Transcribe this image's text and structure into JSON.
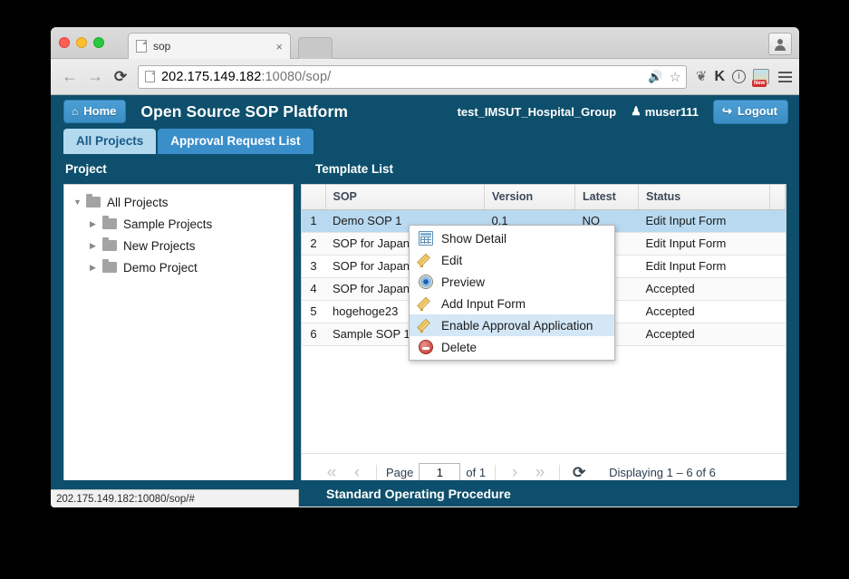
{
  "browser": {
    "tab": {
      "title": "sop",
      "close_label": "×",
      "favicon": "page-icon"
    },
    "nav": {
      "back": "←",
      "forward": "→",
      "reload": "⟳"
    },
    "omnibox": {
      "url_main": "202.175.149.182",
      "url_dim": ":10080/sop/",
      "speaker_icon": "speaker-mute-icon",
      "star_icon": "☆"
    },
    "extensions": [
      {
        "name": "evernote-extension-icon",
        "glyph": "❦"
      },
      {
        "name": "kaspersky-extension-icon",
        "glyph": "K"
      },
      {
        "name": "info-extension-icon",
        "glyph": "i"
      },
      {
        "name": "picture-extension-icon",
        "badge": "New"
      }
    ],
    "menu_icon": "hamburger-menu-icon",
    "profile_icon": "profile-person-icon",
    "status_bubble": "202.175.149.182:10080/sop/#"
  },
  "app": {
    "home_button": "Home",
    "home_icon": "⌂",
    "title": "Open Source SOP Platform",
    "group_name": "test_IMSUT_Hospital_Group",
    "user_name": "muser111",
    "user_icon": "♟",
    "logout_button": "Logout",
    "logout_icon": "↪",
    "tabs": [
      {
        "label": "All Projects",
        "active": true
      },
      {
        "label": "Approval Request List",
        "active": false
      }
    ],
    "footer_text": "Standard Operating Procedure",
    "accent_dark": "#0d4f6c",
    "accent_blue": "#3a8fcb",
    "tab_active_bg": "#b3d9ef",
    "row_selected_bg": "#b8d9ef"
  },
  "project_panel": {
    "header": "Project",
    "tree": [
      {
        "label": "All Projects",
        "level": 0,
        "twisty": "▼"
      },
      {
        "label": "Sample Projects",
        "level": 1,
        "twisty": "▶"
      },
      {
        "label": "New Projects",
        "level": 1,
        "twisty": "▶"
      },
      {
        "label": "Demo Project",
        "level": 1,
        "twisty": "▶"
      }
    ]
  },
  "template_list": {
    "header": "Template List",
    "columns": [
      "",
      "SOP",
      "Version",
      "Latest",
      "Status",
      ""
    ],
    "rows": [
      {
        "num": "1",
        "sop": "Demo SOP 1",
        "version": "0.1",
        "latest": "NO",
        "status": "Edit Input Form"
      },
      {
        "num": "2",
        "sop": "SOP for Japan",
        "version": "",
        "latest": "",
        "status": "Edit Input Form"
      },
      {
        "num": "3",
        "sop": "SOP for Japan",
        "version": "",
        "latest": "",
        "status": "Edit Input Form"
      },
      {
        "num": "4",
        "sop": "SOP for Japan",
        "version": "",
        "latest": "",
        "status": "Accepted"
      },
      {
        "num": "5",
        "sop": "hogehoge23",
        "version": "",
        "latest": "",
        "status": "Accepted"
      },
      {
        "num": "6",
        "sop": "Sample SOP 1",
        "version": "",
        "latest": "",
        "status": "Accepted"
      }
    ]
  },
  "context_menu": {
    "items": [
      {
        "label": "Show Detail",
        "icon": "grid-icon",
        "highlighted": false
      },
      {
        "label": "Edit",
        "icon": "pencil-icon",
        "highlighted": false
      },
      {
        "label": "Preview",
        "icon": "eye-icon",
        "highlighted": false
      },
      {
        "label": "Add Input Form",
        "icon": "pencil-icon",
        "highlighted": false
      },
      {
        "label": "Enable Approval Application",
        "icon": "pencil-icon",
        "highlighted": true
      },
      {
        "label": "Delete",
        "icon": "delete-icon",
        "highlighted": false
      }
    ]
  },
  "paging": {
    "first": "«",
    "prev": "‹",
    "page_label": "Page",
    "page_value": "1",
    "of_label": "of 1",
    "next": "›",
    "last": "»",
    "refresh": "⟳",
    "status": "Displaying 1 – 6 of 6"
  }
}
